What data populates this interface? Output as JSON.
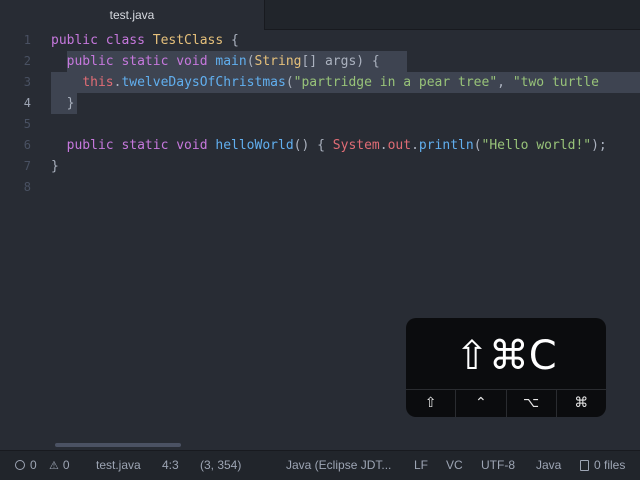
{
  "tab": {
    "title": "test.java"
  },
  "editor": {
    "lines": [
      {
        "num": "1"
      },
      {
        "num": "2"
      },
      {
        "num": "3"
      },
      {
        "num": "4"
      },
      {
        "num": "5"
      },
      {
        "num": "6"
      },
      {
        "num": "7"
      },
      {
        "num": "8"
      }
    ],
    "code": {
      "l1_kw": "public class ",
      "l1_cls": "TestClass",
      "l1_rest": " {",
      "l2_kw": "public static void ",
      "l2_fn": "main",
      "l2_p1": "(",
      "l2_type": "String",
      "l2_rest": "[] args) {",
      "l3_this": "this",
      "l3_dot": ".",
      "l3_fn": "twelveDaysOfChristmas",
      "l3_p1": "(",
      "l3_s1": "\"partridge in a pear tree\"",
      "l3_comma": ", ",
      "l3_s2": "\"two turtle",
      "l4_brace": "}",
      "l6_kw": "public static void ",
      "l6_fn": "helloWorld",
      "l6_p1": "() { ",
      "l6_sys": "System",
      "l6_dot1": ".",
      "l6_out": "out",
      "l6_dot2": ".",
      "l6_fn2": "println",
      "l6_p2": "(",
      "l6_str": "\"Hello world!\"",
      "l6_p3": ");",
      "l7_brace": "}"
    }
  },
  "key_overlay": {
    "combo": "⇧⌘C",
    "modifiers": [
      "⇧",
      "⌃",
      "⌥",
      "⌘"
    ]
  },
  "status": {
    "errors": "0",
    "warnings": "0",
    "file": "test.java",
    "cursor": "4:3",
    "selection": "(3, 354)",
    "grammar": "Java (Eclipse JDT...",
    "line_ending": "LF",
    "vcs": "VC",
    "encoding": "UTF-8",
    "language": "Java",
    "files": "0 files"
  },
  "colors": {
    "background": "#282c34",
    "selection": "#3e4451",
    "keyword": "#c678dd",
    "class": "#e5c07b",
    "function": "#61afef",
    "string": "#98c379",
    "this": "#e06c75"
  }
}
